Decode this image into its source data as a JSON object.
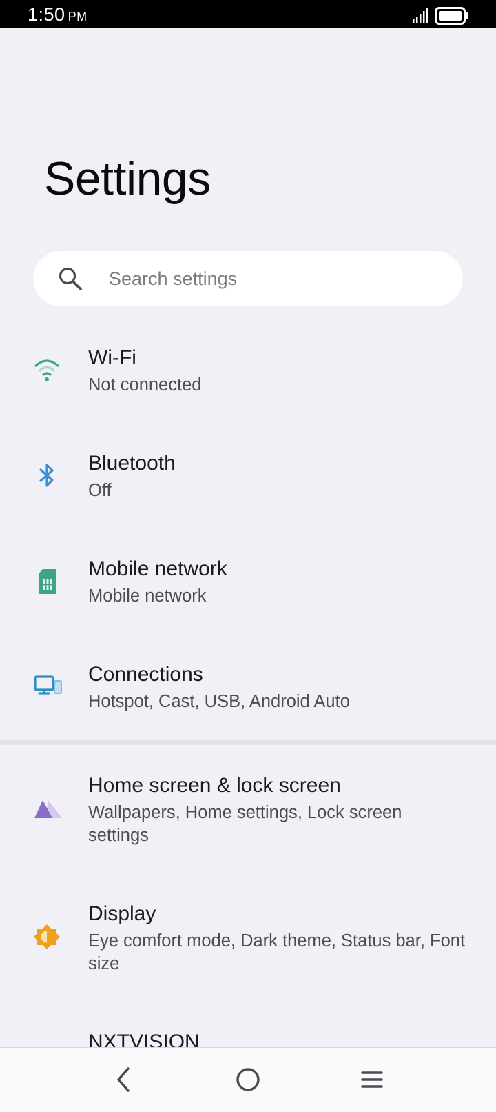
{
  "status_bar": {
    "time": "1:50",
    "ampm": "PM"
  },
  "title": "Settings",
  "search": {
    "placeholder": "Search settings",
    "icon": "search-icon"
  },
  "items": [
    {
      "title": "Wi-Fi",
      "subtitle": "Not connected",
      "icon": "wifi-icon",
      "color": "#3aa58a"
    },
    {
      "title": "Bluetooth",
      "subtitle": "Off",
      "icon": "bluetooth-icon",
      "color": "#3f8fd2"
    },
    {
      "title": "Mobile network",
      "subtitle": "Mobile network",
      "icon": "sim-card-icon",
      "color": "#3aa58a"
    },
    {
      "title": "Connections",
      "subtitle": "Hotspot, Cast, USB, Android Auto",
      "icon": "devices-icon",
      "color": "#2f8fc4"
    },
    {
      "title": "Home screen & lock screen",
      "subtitle": "Wallpapers, Home settings, Lock screen settings",
      "icon": "home-screen-icon",
      "color": "#8a6cc8"
    },
    {
      "title": "Display",
      "subtitle": "Eye comfort mode, Dark theme, Status bar, Font size",
      "icon": "brightness-icon",
      "color": "#f0a020"
    },
    {
      "title": "NXTVISION",
      "subtitle": "",
      "icon": "",
      "color": ""
    }
  ],
  "nav": {
    "back": "back-icon",
    "home": "home-icon",
    "menu": "menu-icon"
  }
}
